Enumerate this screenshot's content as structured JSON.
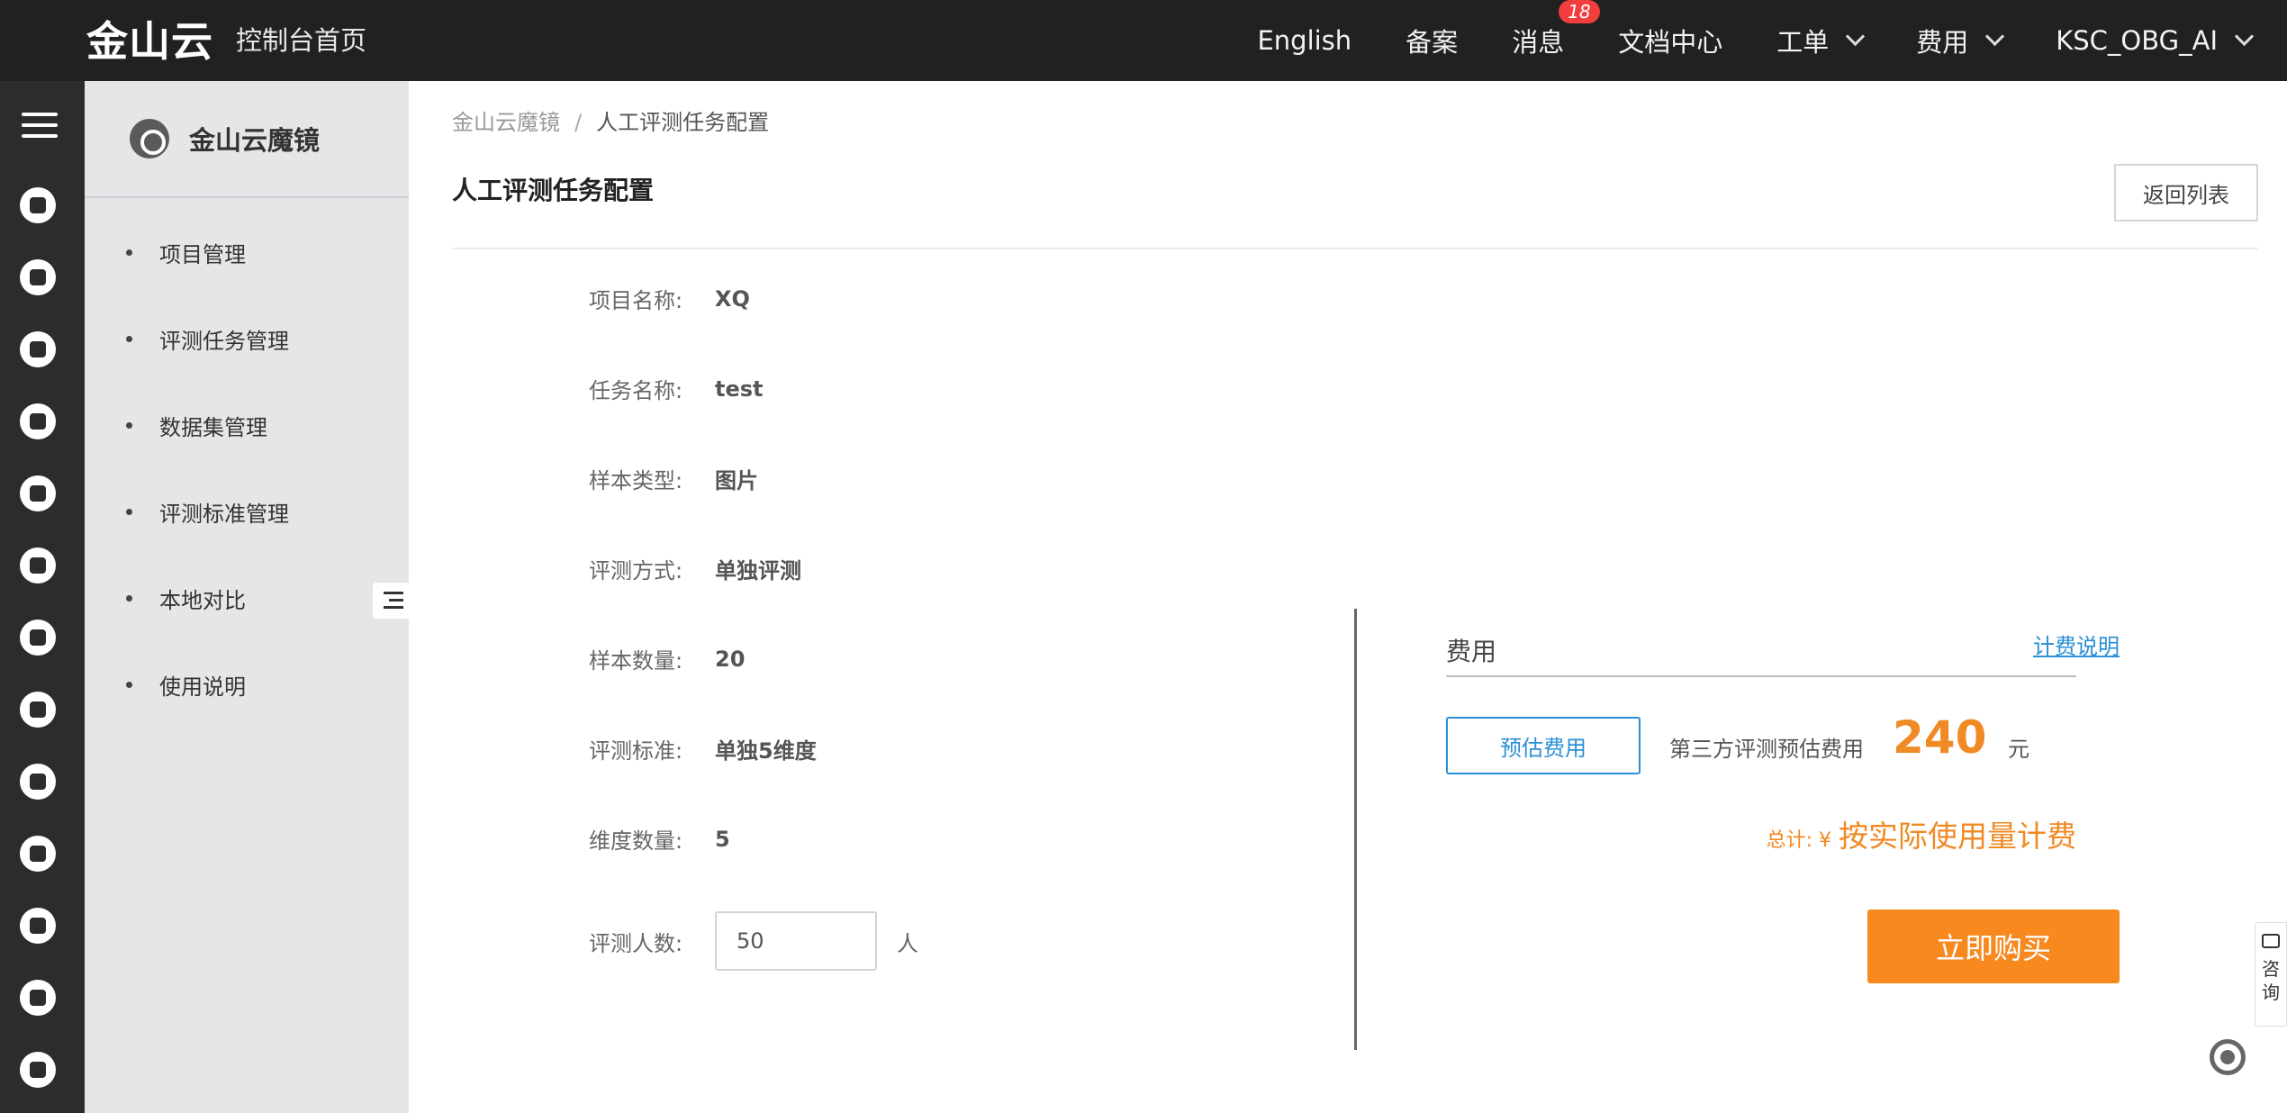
{
  "topbar": {
    "logo": "金山云",
    "console_home": "控制台首页",
    "nav": {
      "english": "English",
      "beian": "备案",
      "messages": "消息",
      "message_count": "18",
      "docs": "文档中心",
      "tickets": "工单",
      "billing": "费用",
      "account": "KSC_OBG_AI"
    }
  },
  "rail": {
    "icons": [
      "menu-icon",
      "cube-icon",
      "badge-icon",
      "wave-icon",
      "server-icon",
      "storage-icon",
      "network-icon",
      "cloud-upload-icon",
      "circle-icon",
      "grid-icon",
      "globe-icon",
      "database-icon",
      "layers-icon",
      "contact-card-icon"
    ]
  },
  "sidebar": {
    "title": "金山云魔镜",
    "items": [
      {
        "label": "项目管理"
      },
      {
        "label": "评测任务管理"
      },
      {
        "label": "数据集管理"
      },
      {
        "label": "评测标准管理"
      },
      {
        "label": "本地对比"
      },
      {
        "label": "使用说明"
      }
    ]
  },
  "breadcrumb": {
    "root": "金山云魔镜",
    "separator": "/",
    "current": "人工评测任务配置"
  },
  "page": {
    "title": "人工评测任务配置",
    "back_button": "返回列表"
  },
  "form": {
    "project_name": {
      "label": "项目名称:",
      "value": "XQ"
    },
    "task_name": {
      "label": "任务名称:",
      "value": "test"
    },
    "sample_type": {
      "label": "样本类型:",
      "value": "图片"
    },
    "eval_method": {
      "label": "评测方式:",
      "value": "单独评测"
    },
    "sample_count": {
      "label": "样本数量:",
      "value": "20"
    },
    "eval_standard": {
      "label": "评测标准:",
      "value": "单独5维度"
    },
    "dimension_count": {
      "label": "维度数量:",
      "value": "5"
    },
    "evaluator_count": {
      "label": "评测人数:",
      "value": "50",
      "unit": "人"
    }
  },
  "fee": {
    "title": "费用",
    "billing_link": "计费说明",
    "estimate_button": "预估费用",
    "estimate_label": "第三方评测预估费用",
    "estimate_value": "240",
    "estimate_unit": "元",
    "total_label": "总计: ¥",
    "total_value": "按实际使用量计费",
    "buy_button": "立即购买"
  },
  "floating": {
    "consult_1": "咨",
    "consult_2": "询"
  },
  "colors": {
    "accent_orange": "#f7891f",
    "link_blue": "#2a8fd6",
    "topbar_bg": "#212121",
    "badge_red": "#f23d3d"
  }
}
